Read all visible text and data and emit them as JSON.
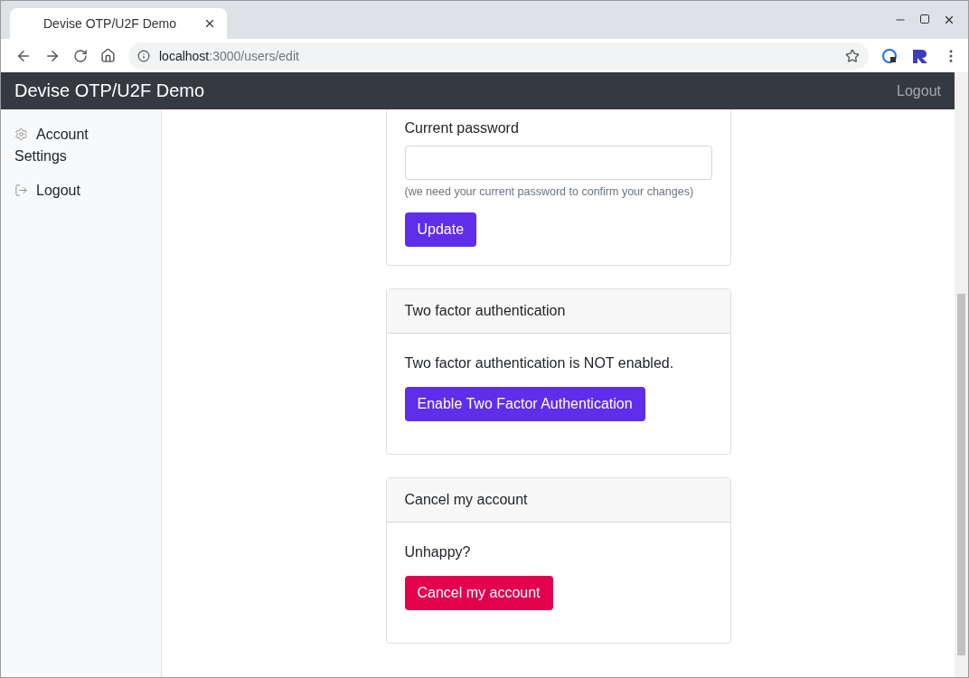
{
  "browser": {
    "tab_title": "Devise OTP/U2F Demo",
    "url_host": "localhost",
    "url_path": ":3000/users/edit"
  },
  "navbar": {
    "brand": "Devise OTP/U2F Demo",
    "link": "Logout"
  },
  "sidebar": {
    "items": [
      {
        "label": "Account Settings",
        "kind": "settings"
      },
      {
        "label": "Logout",
        "kind": "logout"
      }
    ]
  },
  "cards": [
    {
      "label": "Current password",
      "hint": "(we need your current password to confirm your changes)",
      "button": {
        "label": "Update",
        "kind": "primary"
      }
    },
    {
      "header": "Two factor authentication",
      "text": "Two factor authentication is NOT enabled.",
      "button": {
        "label": "Enable Two Factor Authentication",
        "kind": "primary"
      }
    },
    {
      "header": "Cancel my account",
      "text": "Unhappy?",
      "button": {
        "label": "Cancel my account",
        "kind": "danger"
      }
    }
  ]
}
